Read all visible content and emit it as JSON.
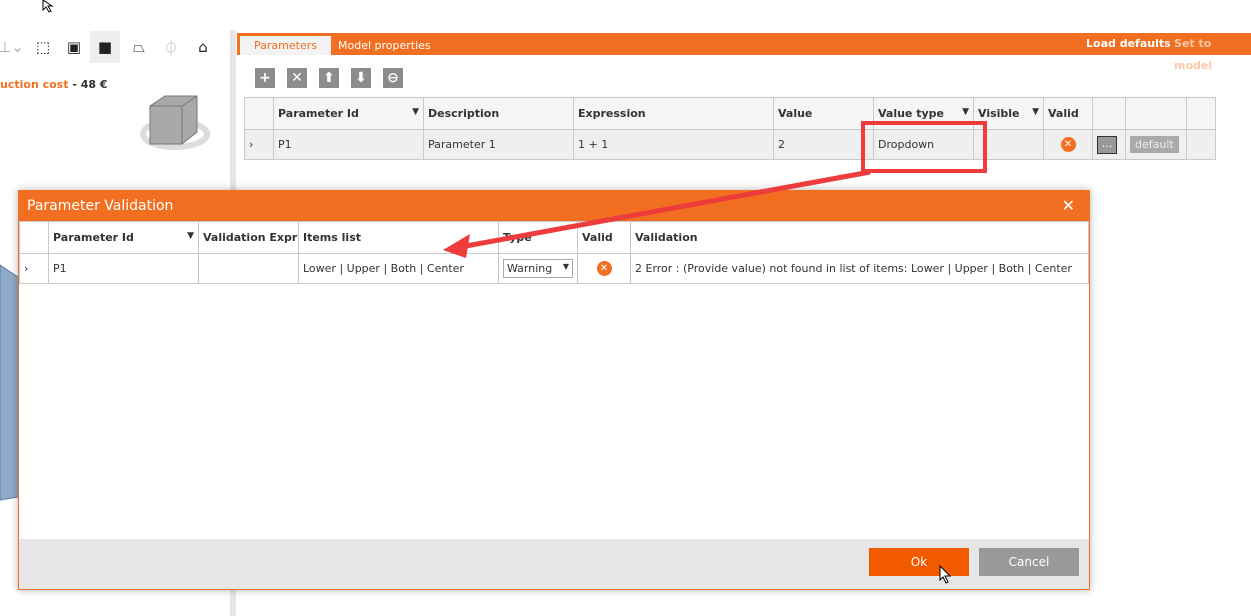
{
  "left": {
    "cost_label": "uction cost",
    "cost_sep": "-",
    "cost_value": "48 €"
  },
  "tabs": [
    {
      "label": "Parameters",
      "active": true
    },
    {
      "label": "Model properties"
    }
  ],
  "actions": {
    "load_defaults": "Load defaults",
    "set_to_model": "Set to model"
  },
  "toolbar": [
    "add-icon",
    "delete-icon",
    "move-up-icon",
    "move-down-icon",
    "link-icon"
  ],
  "params_table": {
    "headers": [
      "Parameter Id",
      "Description",
      "Expression",
      "Value",
      "Value type",
      "Visible",
      "Valid"
    ],
    "row": {
      "id": "P1",
      "description": "Parameter 1",
      "expression": "1 + 1",
      "value": "2",
      "value_type": "Dropdown",
      "ellipsis": "...",
      "default": "default"
    }
  },
  "dialog": {
    "title": "Parameter Validation",
    "headers": [
      "Parameter Id",
      "Validation Expre",
      "Items list",
      "Type",
      "Valid",
      "Validation"
    ],
    "row": {
      "id": "P1",
      "expression": "",
      "items": "Lower | Upper | Both | Center",
      "type": "Warning",
      "validation": "2 Error : (Provide value) not found in list of items:   Lower | Upper | Both | Center"
    },
    "ok": "Ok",
    "cancel": "Cancel"
  },
  "colors": {
    "accent": "#f26f21",
    "annotation": "#ee3b3b"
  }
}
